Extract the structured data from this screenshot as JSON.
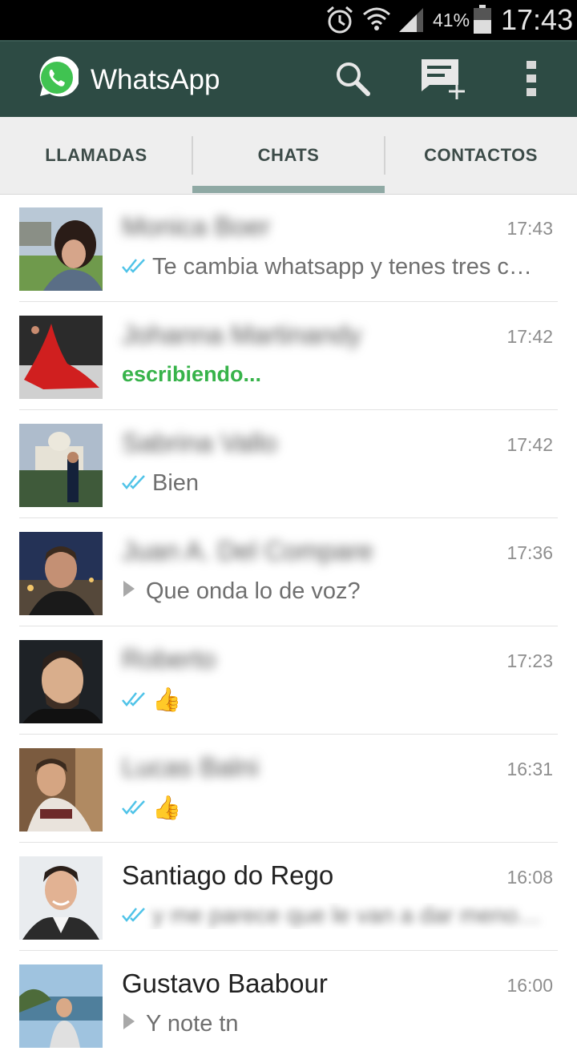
{
  "status_bar": {
    "battery_percent": "41%",
    "time": "17:43",
    "icons": [
      "alarm-icon",
      "wifi-icon",
      "signal-icon",
      "battery-icon"
    ]
  },
  "action_bar": {
    "title": "WhatsApp",
    "icons": [
      "whatsapp-logo",
      "search-icon",
      "new-chat-icon",
      "overflow-menu-icon"
    ]
  },
  "tabs": {
    "items": [
      {
        "label": "LLAMADAS"
      },
      {
        "label": "CHATS"
      },
      {
        "label": "CONTACTOS"
      }
    ],
    "selected": "CHATS"
  },
  "chats": [
    {
      "name": "Monica Boer",
      "time": "17:43",
      "preview": "Te cambia whatsapp y tenes tres c…",
      "status": "read"
    },
    {
      "name": "Johanna Martinandy",
      "time": "17:42",
      "preview": "escribiendo...",
      "status": "typing"
    },
    {
      "name": "Sabrina Vallo",
      "time": "17:42",
      "preview": "Bien",
      "status": "read"
    },
    {
      "name": "Juan A. Del Compare",
      "time": "17:36",
      "preview": "Que onda lo de voz?",
      "status": "voice"
    },
    {
      "name": "Roberto",
      "time": "17:23",
      "preview": "👍",
      "status": "read"
    },
    {
      "name": "Lucas Balni",
      "time": "16:31",
      "preview": "👍",
      "status": "read"
    },
    {
      "name": "Santiago do Rego",
      "time": "16:08",
      "preview": "y me parece que le van a dar meno…",
      "status": "read"
    },
    {
      "name": "Gustavo Baabour",
      "time": "16:00",
      "preview": "Y note tn",
      "status": "voice"
    }
  ],
  "colors": {
    "action_bar": "#2d4b44",
    "tab_indicator": "#8fa9a4",
    "typing": "#37b34a",
    "read_ticks": "#4fc3e8"
  }
}
